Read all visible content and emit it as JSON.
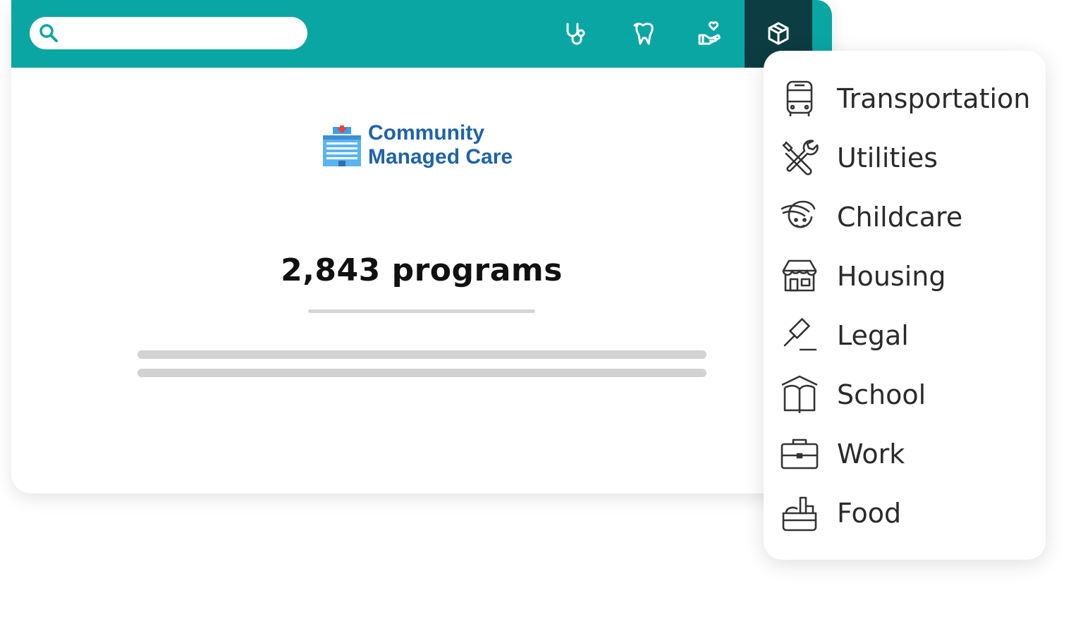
{
  "search": {
    "placeholder": "",
    "value": ""
  },
  "nav": {
    "buttons": [
      {
        "name": "stethoscope-icon"
      },
      {
        "name": "tooth-icon"
      },
      {
        "name": "hand-heart-icon"
      },
      {
        "name": "cube-box-icon",
        "active": true
      }
    ]
  },
  "brand": {
    "line1": "Community",
    "line2": "Managed Care"
  },
  "summary": {
    "count_text": "2,843 programs"
  },
  "categories": [
    {
      "label": "Transportation",
      "icon": "bus-icon"
    },
    {
      "label": "Utilities",
      "icon": "tools-icon"
    },
    {
      "label": "Childcare",
      "icon": "child-face-icon"
    },
    {
      "label": "Housing",
      "icon": "house-icon"
    },
    {
      "label": "Legal",
      "icon": "gavel-icon"
    },
    {
      "label": "School",
      "icon": "book-school-icon"
    },
    {
      "label": "Work",
      "icon": "briefcase-icon"
    },
    {
      "label": "Food",
      "icon": "food-basket-icon"
    }
  ],
  "colors": {
    "topbar": "#0aa6a3",
    "active_nav": "#0c3d42",
    "brand": "#1d63a8"
  }
}
